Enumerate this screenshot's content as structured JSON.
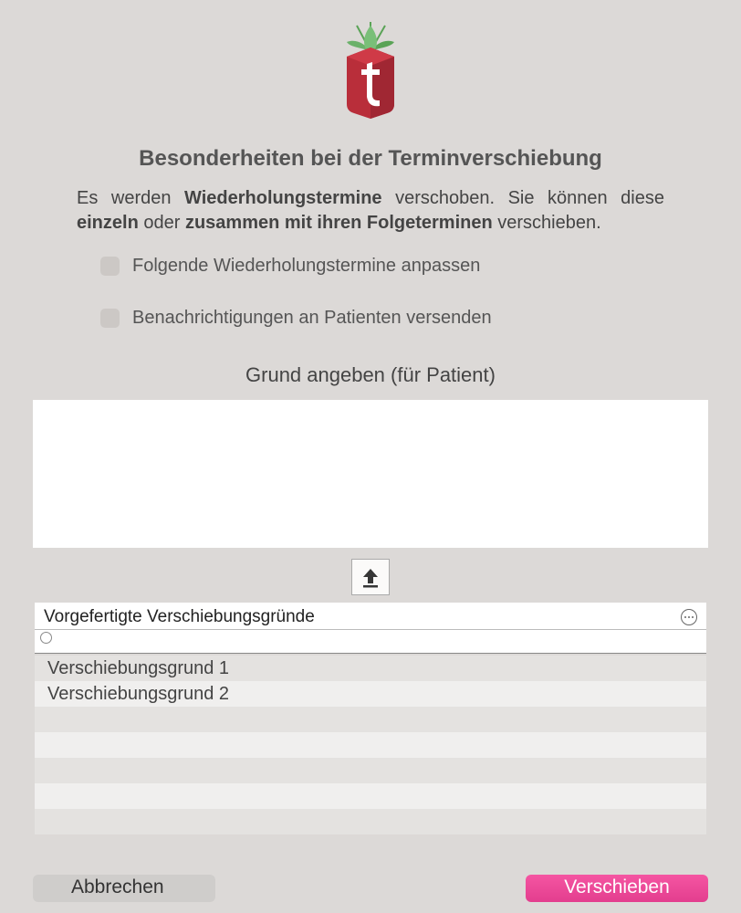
{
  "title": "Besonderheiten bei der Terminverschiebung",
  "description": {
    "t1": "Es werden",
    "b1": "Wiederholungstermine",
    "t2": "verschoben. Sie können diese",
    "b2": "einzeln",
    "t3": "oder",
    "b3": "zusammen mit ihren Folgeterminen",
    "t4": "verschieben."
  },
  "checkbox1": "Folgende Wiederholungstermine anpassen",
  "checkbox2": "Benachrichtigungen an Patienten versenden",
  "reasonLabel": "Grund angeben (für Patient)",
  "presetsHeader": "Vorgefertigte Verschiebungsgründe",
  "presetOptions": [
    "Verschiebungsgrund 1",
    "Verschiebungsgrund 2"
  ],
  "cancelLabel": "Abbrechen",
  "confirmLabel": "Verschieben"
}
